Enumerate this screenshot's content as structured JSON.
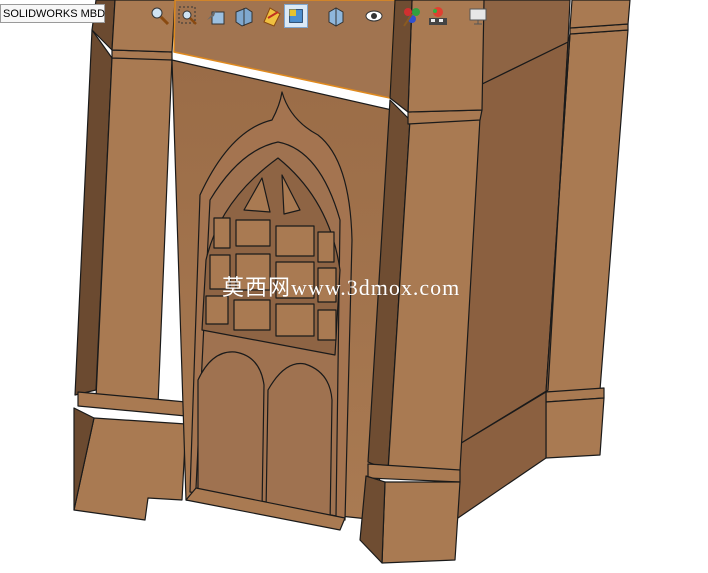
{
  "tab": {
    "label": "SOLIDWORKS MBD"
  },
  "watermark": {
    "text": "莫西网www.3dmox.com"
  },
  "toolbar": {
    "items": [
      {
        "icon": "zoom-to-fit-icon"
      },
      {
        "icon": "zoom-to-area-icon"
      },
      {
        "icon": "previous-view-icon"
      },
      {
        "icon": "section-view-icon"
      },
      {
        "icon": "dynamic-annotation-views-icon"
      },
      {
        "icon": "view-orientation-icon",
        "active": true
      },
      {
        "icon": "display-style-icon"
      },
      {
        "icon": "hide-show-items-icon"
      },
      {
        "icon": "edit-appearance-icon"
      },
      {
        "icon": "apply-scene-icon"
      },
      {
        "icon": "view-settings-icon"
      }
    ]
  },
  "model": {
    "color": "#a8764e",
    "edge_color": "#1a1a1a",
    "selected_edge_color": "#e08a1e"
  }
}
